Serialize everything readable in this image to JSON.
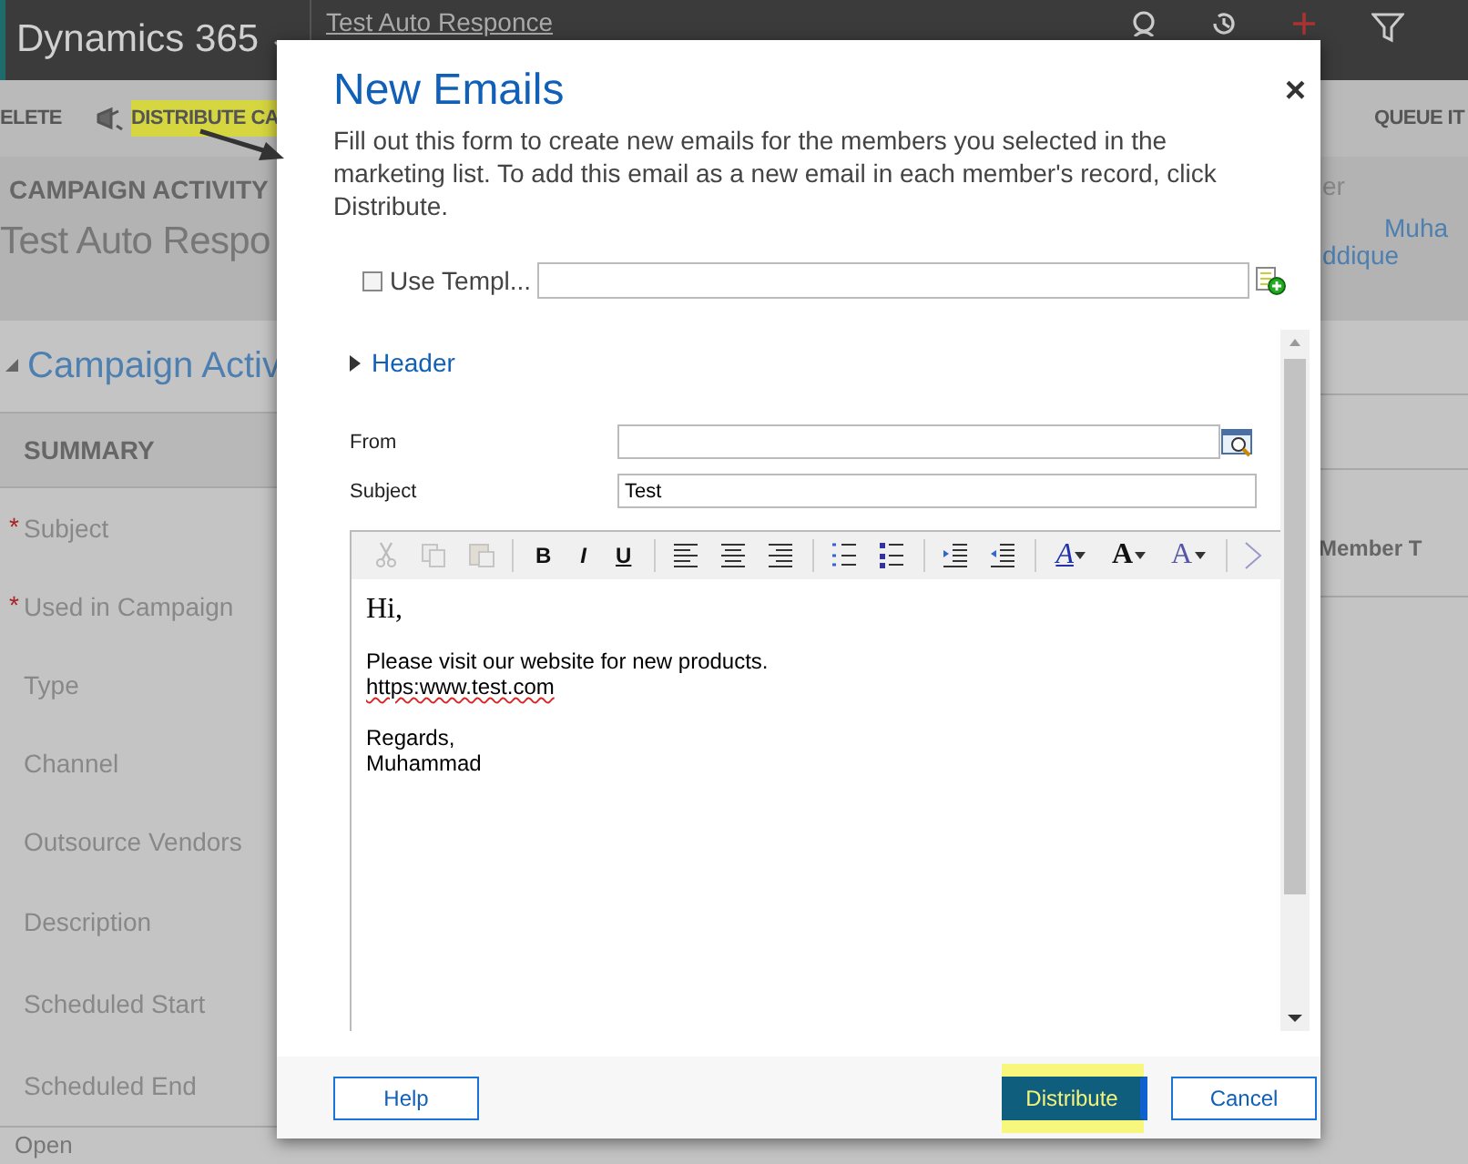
{
  "app_bar": {
    "title": "Dynamics 365",
    "breadcrumb": "Test Auto Responce"
  },
  "command_bar": {
    "items": [
      {
        "label": "ELETE",
        "highlighted": false
      },
      {
        "label": "DISTRIBUTE CA",
        "highlighted": true
      },
      {
        "label": "QUEUE IT",
        "highlighted": false
      }
    ]
  },
  "record": {
    "entity": "CAMPAIGN ACTIVITY",
    "title": "Test Auto Respo",
    "owner_label": "er",
    "owner_lines": [
      "Muha",
      "ddique"
    ]
  },
  "section": {
    "title": "Campaign Activ"
  },
  "summary": {
    "heading": "SUMMARY",
    "fields": [
      {
        "label": "Subject",
        "marker": "*"
      },
      {
        "label": "Used in Campaign",
        "marker": "*"
      },
      {
        "label": "Type"
      },
      {
        "label": "Channel"
      },
      {
        "label": "Outsource Vendors"
      },
      {
        "label": "Description"
      },
      {
        "label": "Scheduled Start"
      },
      {
        "label": "Scheduled End"
      }
    ]
  },
  "side_column": {
    "header": "Member T"
  },
  "status": "Open",
  "dialog": {
    "title": "New Emails",
    "close": "×",
    "description": "Fill out this form to create new emails for the members you selected in the marketing list. To add this email as a new email in each member's record, click Distribute.",
    "template": {
      "label": "Use Templ...",
      "checked": false
    },
    "header_section": {
      "label": "Header",
      "expanded": false
    },
    "fields": [
      {
        "label": "From",
        "kind": "lookup"
      },
      {
        "label": "Subject",
        "value": "Test",
        "kind": "text"
      }
    ],
    "toolbar": [
      {
        "kind": "cut",
        "disabled": true
      },
      {
        "kind": "copy",
        "disabled": true
      },
      {
        "kind": "paste",
        "disabled": true
      },
      {
        "kind": "sep"
      },
      {
        "kind": "bold",
        "text": "B"
      },
      {
        "kind": "italic",
        "text": "I"
      },
      {
        "kind": "underline",
        "text": "U"
      },
      {
        "kind": "sep"
      },
      {
        "kind": "align-left"
      },
      {
        "kind": "align-center"
      },
      {
        "kind": "align-right"
      },
      {
        "kind": "sep"
      },
      {
        "kind": "numbered-list"
      },
      {
        "kind": "bullet-list"
      },
      {
        "kind": "sep"
      },
      {
        "kind": "indent"
      },
      {
        "kind": "outdent"
      },
      {
        "kind": "sep"
      },
      {
        "kind": "font-color",
        "text": "A"
      },
      {
        "kind": "font-size",
        "text": "A"
      },
      {
        "kind": "font",
        "text": "A"
      },
      {
        "kind": "sep"
      },
      {
        "kind": "more"
      }
    ],
    "body": {
      "greeting": "Hi,",
      "lines": [
        {
          "text": "Please visit our website for new products.",
          "misspelled": false
        },
        {
          "text": "https:www.test.com",
          "misspelled": true
        },
        {
          "text": "Regards,",
          "misspelled": false,
          "space_before": true
        },
        {
          "text": "Muhammad",
          "misspelled": false
        }
      ]
    },
    "buttons": [
      {
        "label": "Help",
        "kind": "secondary",
        "highlighted": false
      },
      {
        "label": "Distribute",
        "kind": "primary",
        "highlighted": true
      },
      {
        "label": "Cancel",
        "kind": "secondary",
        "highlighted": false
      }
    ]
  }
}
